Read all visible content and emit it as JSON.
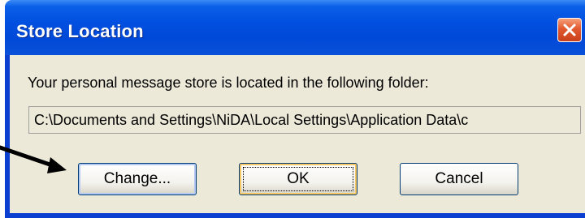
{
  "window": {
    "title": "Store Location",
    "close_icon": "close-icon"
  },
  "message": "Your personal message store is located in the following folder:",
  "folder_path": "C:\\Documents and Settings\\NiDA\\Local Settings\\Application Data\\c",
  "buttons": {
    "change_label": "Change...",
    "ok_label": "OK",
    "cancel_label": "Cancel"
  },
  "annotation": {
    "arrow_icon": "arrow-right-icon",
    "color": "#000000"
  },
  "colors": {
    "titlebar": "#0250e0",
    "dialog_background": "#ece9d8",
    "close_button": "#e2582e"
  }
}
